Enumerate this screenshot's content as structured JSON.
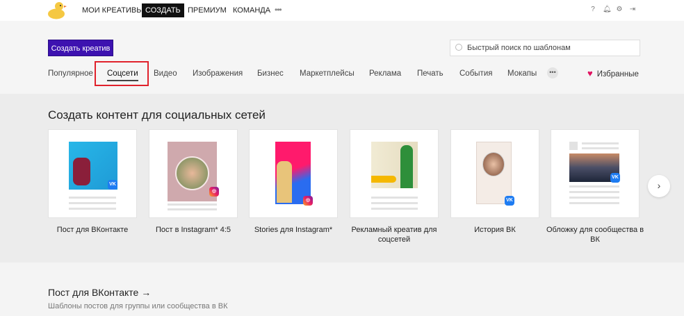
{
  "header": {
    "nav": [
      "МОИ КРЕАТИВЫ",
      "СОЗДАТЬ",
      "ПРЕМИУМ",
      "КОМАНДА"
    ],
    "active": "СОЗДАТЬ",
    "more": "•••",
    "icons": [
      "help-icon",
      "bell-icon",
      "gear-icon",
      "logout-icon"
    ]
  },
  "toolbar": {
    "create_label": "Создать креатив",
    "search_placeholder": "Быстрый поиск по шаблонам"
  },
  "tabs": [
    "Популярное",
    "Соцсети",
    "Видео",
    "Изображения",
    "Бизнес",
    "Маркетплейсы",
    "Реклама",
    "Печать",
    "События",
    "Мокапы"
  ],
  "selected_tab": "Соцсети",
  "tabs_more": "•••",
  "favorites": "Избранные",
  "accent": "#3d12b0",
  "highlight": "#e0212b",
  "section": {
    "title": "Создать контент для социальных сетей",
    "cards": [
      {
        "label": "Пост для ВКонтакте",
        "badge": "vk"
      },
      {
        "label": "Пост в Instagram* 4:5",
        "badge": "instagram"
      },
      {
        "label": "Stories для Instagram*",
        "badge": "instagram"
      },
      {
        "label": "Рекламный креатив для соцсетей",
        "badge": "none"
      },
      {
        "label": "История ВК",
        "badge": "vk"
      },
      {
        "label": "Обложку для сообщества в ВК",
        "badge": "vk"
      }
    ],
    "next": "›"
  },
  "next_section": {
    "title": "Пост для ВКонтакте →",
    "subtitle": "Шаблоны постов для группы или сообщества в ВК"
  }
}
